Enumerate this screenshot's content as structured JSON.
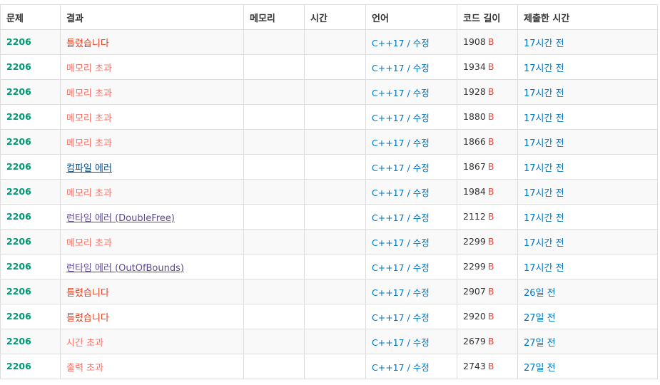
{
  "headers": {
    "problem": "문제",
    "result": "결과",
    "memory": "메모리",
    "time": "시간",
    "language": "언어",
    "code_length": "코드 길이",
    "submit_time": "제출한 시간"
  },
  "rows": [
    {
      "problem": "2206",
      "result": "틀렸습니다",
      "result_type": "wa",
      "memory": "",
      "time": "",
      "language": "C++17",
      "edit": "수정",
      "length": "1908",
      "length_unit": "B",
      "submitted": "17시간 전"
    },
    {
      "problem": "2206",
      "result": "메모리 초과",
      "result_type": "mle",
      "memory": "",
      "time": "",
      "language": "C++17",
      "edit": "수정",
      "length": "1934",
      "length_unit": "B",
      "submitted": "17시간 전"
    },
    {
      "problem": "2206",
      "result": "메모리 초과",
      "result_type": "mle",
      "memory": "",
      "time": "",
      "language": "C++17",
      "edit": "수정",
      "length": "1928",
      "length_unit": "B",
      "submitted": "17시간 전"
    },
    {
      "problem": "2206",
      "result": "메모리 초과",
      "result_type": "mle",
      "memory": "",
      "time": "",
      "language": "C++17",
      "edit": "수정",
      "length": "1880",
      "length_unit": "B",
      "submitted": "17시간 전"
    },
    {
      "problem": "2206",
      "result": "메모리 초과",
      "result_type": "mle",
      "memory": "",
      "time": "",
      "language": "C++17",
      "edit": "수정",
      "length": "1866",
      "length_unit": "B",
      "submitted": "17시간 전"
    },
    {
      "problem": "2206",
      "result": "컴파일 에러",
      "result_type": "ce",
      "memory": "",
      "time": "",
      "language": "C++17",
      "edit": "수정",
      "length": "1867",
      "length_unit": "B",
      "submitted": "17시간 전"
    },
    {
      "problem": "2206",
      "result": "메모리 초과",
      "result_type": "mle",
      "memory": "",
      "time": "",
      "language": "C++17",
      "edit": "수정",
      "length": "1984",
      "length_unit": "B",
      "submitted": "17시간 전"
    },
    {
      "problem": "2206",
      "result": "런타임 에러 (DoubleFree)",
      "result_type": "rte",
      "memory": "",
      "time": "",
      "language": "C++17",
      "edit": "수정",
      "length": "2112",
      "length_unit": "B",
      "submitted": "17시간 전"
    },
    {
      "problem": "2206",
      "result": "메모리 초과",
      "result_type": "mle",
      "memory": "",
      "time": "",
      "language": "C++17",
      "edit": "수정",
      "length": "2299",
      "length_unit": "B",
      "submitted": "17시간 전"
    },
    {
      "problem": "2206",
      "result": "런타임 에러 (OutOfBounds)",
      "result_type": "rte",
      "memory": "",
      "time": "",
      "language": "C++17",
      "edit": "수정",
      "length": "2299",
      "length_unit": "B",
      "submitted": "17시간 전"
    },
    {
      "problem": "2206",
      "result": "틀렸습니다",
      "result_type": "wa",
      "memory": "",
      "time": "",
      "language": "C++17",
      "edit": "수정",
      "length": "2907",
      "length_unit": "B",
      "submitted": "26일 전"
    },
    {
      "problem": "2206",
      "result": "틀렸습니다",
      "result_type": "wa",
      "memory": "",
      "time": "",
      "language": "C++17",
      "edit": "수정",
      "length": "2920",
      "length_unit": "B",
      "submitted": "27일 전"
    },
    {
      "problem": "2206",
      "result": "시간 초과",
      "result_type": "tle",
      "memory": "",
      "time": "",
      "language": "C++17",
      "edit": "수정",
      "length": "2679",
      "length_unit": "B",
      "submitted": "27일 전"
    },
    {
      "problem": "2206",
      "result": "출력 초과",
      "result_type": "ole",
      "memory": "",
      "time": "",
      "language": "C++17",
      "edit": "수정",
      "length": "2743",
      "length_unit": "B",
      "submitted": "27일 전"
    }
  ],
  "colors": {
    "problem": "#009874",
    "wrong_answer": "#dd4124",
    "limit_exceeded": "#fa7268",
    "compile_error": "#0f4c81",
    "runtime_error": "#5f4b8b",
    "link": "#0076c0",
    "byte_unit": "#e74c3c"
  }
}
